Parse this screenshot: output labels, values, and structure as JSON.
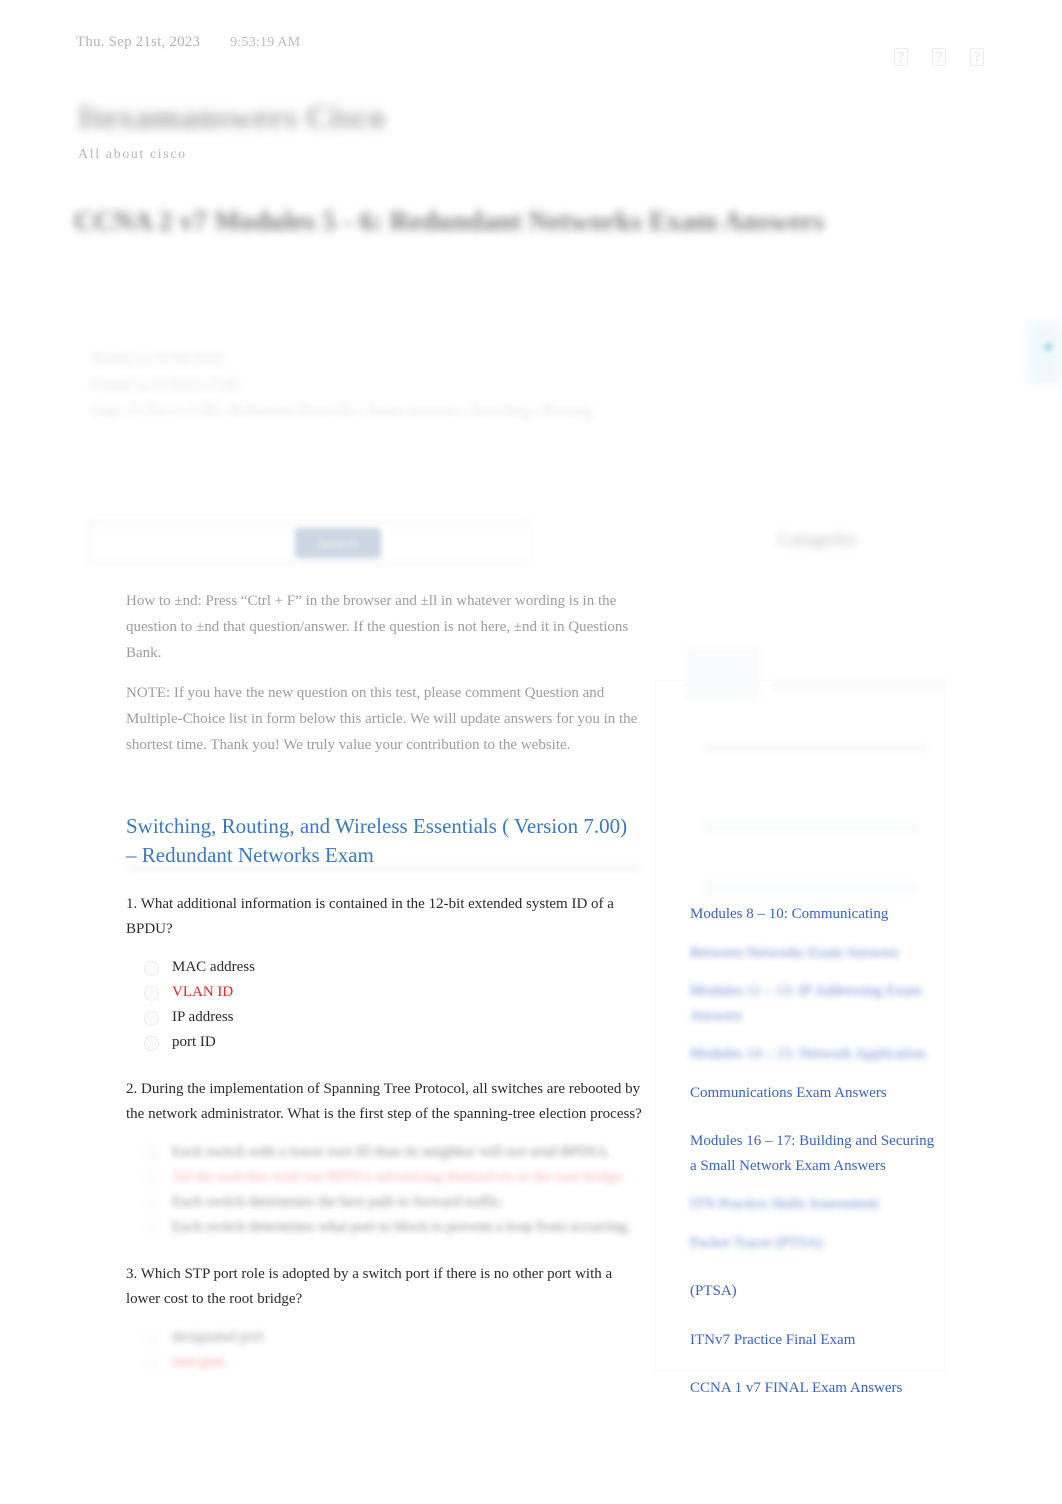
{
  "topbar": {
    "date": "Thu. Sep 21st, 2023",
    "time": "9:53:19 AM",
    "social_icons": [
      "facebook-icon",
      "twitter-icon",
      "youtube-icon"
    ]
  },
  "site": {
    "title": "Itexamanswers Cisco",
    "tagline": "All about cisco"
  },
  "entry": {
    "title": "CCNA 2 v7 Modules 5 - 6: Redundant Networks Exam Answers",
    "meta_line_1": "Posted on 05/06/2020",
    "meta_line_2": "Posted in CCNA2 v7.00",
    "meta_line_3": "Tags: CCNA 2 v7.00 / Redundant Networks / Exam Answers / Switching / Routing"
  },
  "search": {
    "placeholder": "",
    "value": "",
    "button_label": "Search"
  },
  "sidebar": {
    "widget_title": "Categories",
    "links": [
      {
        "label": "Modules 8 – 10: Communicating",
        "blurred": false
      },
      {
        "label": "Between Networks Exam Answers",
        "blurred": true
      },
      {
        "label": "Modules 11 – 13: IP Addressing Exam Answers",
        "blurred": true
      },
      {
        "label": "Modules 14 – 15: Network Application",
        "blurred": true
      },
      {
        "label": "Communications Exam Answers",
        "blurred": false
      },
      {
        "label": "Modules 16 – 17: Building and Securing a Small Network Exam Answers",
        "blurred": false
      },
      {
        "label": "ITN Practice Skills Assessment",
        "blurred": true
      },
      {
        "label": "Packet Tracer (PTSA)",
        "blurred": true
      },
      {
        "label": "(PTSA)",
        "blurred": false
      },
      {
        "label": "ITNv7 Practice Final Exam",
        "blurred": false
      },
      {
        "label": "CCNA 1 v7 FINAL Exam Answers",
        "blurred": false
      }
    ]
  },
  "content": {
    "notice_1": "How to ±nd:   Press “Ctrl + F” in the browser and ±ll in whatever wording is in the question to ±nd that question/answer. If the question is not here, ±nd it in Questions Bank.",
    "notice_2": "NOTE: If you have the new question on this test, please comment Question and Multiple-Choice list in form below this article. We will update answers for you in the shortest time. Thank you! We truly value your contribution to the website.",
    "section_title": "Switching, Routing, and Wireless Essentials ( Version 7.00) – Redundant Networks Exam",
    "questions": [
      {
        "text": "1. What additional information is contained in the 12-bit extended system ID of a BPDU?",
        "blurred": false,
        "answers": [
          {
            "label": "MAC address",
            "correct": false
          },
          {
            "label": "VLAN ID",
            "correct": true
          },
          {
            "label": "IP address",
            "correct": false
          },
          {
            "label": "port ID",
            "correct": false
          }
        ]
      },
      {
        "text": "2. During the implementation of Spanning Tree Protocol, all switches are rebooted by the network administrator. What is the first step of the spanning-tree election process?",
        "blurred": true,
        "answers": [
          {
            "label": "Each switch with a lower root ID than its neighbor will not send BPDUs.",
            "correct": false
          },
          {
            "label": "All the switches send out BPDUs advertising themselves as the root bridge.",
            "correct": true
          },
          {
            "label": "Each switch determines the best path to forward traffic.",
            "correct": false
          },
          {
            "label": "Each switch determines what port to block to prevent a loop from occurring.",
            "correct": false
          }
        ]
      },
      {
        "text": "3. Which STP port role is adopted by a switch port if there is no other port with a lower cost to the root bridge?",
        "blurred": true,
        "answers": [
          {
            "label": "designated port",
            "correct": false
          },
          {
            "label": "root port",
            "correct": true
          }
        ]
      }
    ]
  },
  "colors": {
    "link_blue": "#3a63c0",
    "heading_blue": "#3a78c2",
    "correct_red": "#ef2020",
    "button_blue": "#c3cfdd",
    "side_tab": "#e3f3f7"
  }
}
